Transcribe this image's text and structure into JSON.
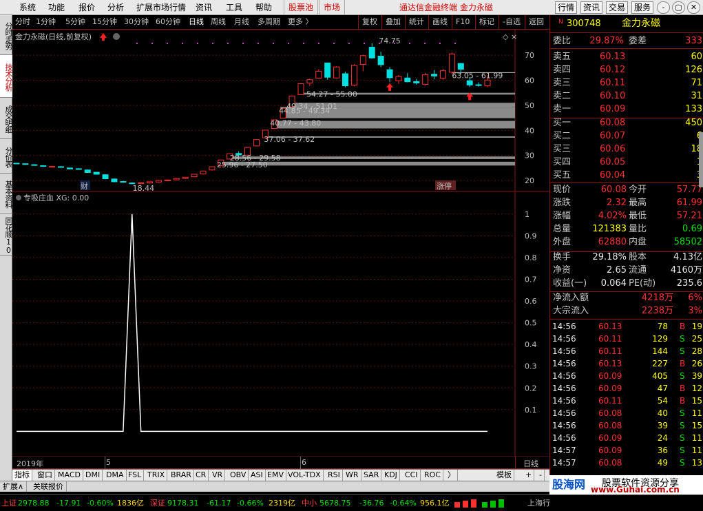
{
  "menubar": {
    "items": [
      "系统",
      "功能",
      "报价",
      "分析",
      "扩展市场行情",
      "资讯",
      "工具",
      "帮助",
      "股票池",
      "市场",
      "通达信金融终端  金力永磁"
    ],
    "right_buttons": [
      "行情",
      "资讯",
      "交易",
      "服务"
    ],
    "win_buttons": [
      "-",
      "▢",
      "✕"
    ]
  },
  "left_tabs": [
    "分时走势",
    "技术分析",
    "成交明细",
    "分价表",
    "基本资料",
    "同花顺10"
  ],
  "period_tabs": [
    "分时",
    "1分钟",
    "5分钟",
    "15分钟",
    "30分钟",
    "60分钟",
    "日线",
    "周线",
    "月线",
    "多周期",
    "更多 〉"
  ],
  "toolbar_buttons": [
    "复权",
    "叠加",
    "统计",
    "画线",
    "F10",
    "标记",
    "-自选",
    "返回"
  ],
  "chart_header": "金力永磁(日线,前复权)",
  "indicator_header": "专吸庄血  XG: 0.00",
  "date_labels": [
    "2019年",
    "5",
    "6"
  ],
  "period_label": "日线",
  "indicators": [
    "指标",
    "窗口",
    "MACD",
    "DMI",
    "DMA",
    "FSL",
    "TRIX",
    "BRAR",
    "CR",
    "VR",
    "OBV",
    "ASI",
    "EMV",
    "VOL-TDX",
    "RSI",
    "WR",
    "SAR",
    "KDJ",
    "CCI",
    "ROC",
    "〉",
    "模板",
    "+",
    "-"
  ],
  "ext_tabs": [
    "扩展∧",
    "关联报价"
  ],
  "status": {
    "sh_label": "上证",
    "sh_val": "2978.88",
    "sh_chg": "-17.91",
    "sh_pct": "-0.60%",
    "sh_amt": "1836亿",
    "sz_label": "深证",
    "sz_val": "9178.31",
    "sz_chg": "-61.17",
    "sz_pct": "-0.66%",
    "sz_amt": "2319亿",
    "zx_label": "中小",
    "zx_val": "5678.75",
    "zx_chg": "-36.76",
    "zx_pct": "-0.64%",
    "zx_amt": "956.1亿",
    "right": "上海行"
  },
  "stock": {
    "flag": "N",
    "code": "300748",
    "name": "金力永磁"
  },
  "weibi": {
    "l1": "委比",
    "v1": "29.87%",
    "l2": "委差",
    "v2": "333"
  },
  "asks": [
    {
      "label": "卖五",
      "price": "60.13",
      "vol": "60"
    },
    {
      "label": "卖四",
      "price": "60.12",
      "vol": "126"
    },
    {
      "label": "卖三",
      "price": "60.11",
      "vol": "71"
    },
    {
      "label": "卖二",
      "price": "60.10",
      "vol": "31"
    },
    {
      "label": "卖一",
      "price": "60.09",
      "vol": "133"
    }
  ],
  "bids": [
    {
      "label": "买一",
      "price": "60.08",
      "vol": "450"
    },
    {
      "label": "买二",
      "price": "60.07",
      "vol": "6"
    },
    {
      "label": "买三",
      "price": "60.06",
      "vol": "18"
    },
    {
      "label": "买四",
      "price": "60.05",
      "vol": "1"
    },
    {
      "label": "买五",
      "price": "60.04",
      "vol": "3"
    }
  ],
  "quote": [
    {
      "l1": "现价",
      "v1": "60.08",
      "l2": "今开",
      "v2": "57.77"
    },
    {
      "l1": "涨跌",
      "v1": "2.32",
      "l2": "最高",
      "v2": "61.99"
    },
    {
      "l1": "涨幅",
      "v1": "4.02%",
      "l2": "最低",
      "v2": "57.21"
    },
    {
      "l1": "总量",
      "v1": "121383",
      "l2": "量比",
      "v2": "0.69"
    },
    {
      "l1": "外盘",
      "v1": "62880",
      "l2": "内盘",
      "v2": "58502"
    }
  ],
  "fund": [
    {
      "l1": "换手",
      "v1": "29.18%",
      "l2": "股本",
      "v2": "4.13亿"
    },
    {
      "l1": "净资",
      "v1": "2.65",
      "l2": "流通",
      "v2": "4160万"
    },
    {
      "l1": "收益(一)",
      "v1": "0.064",
      "l2": "PE(动)",
      "v2": "235.6"
    }
  ],
  "flow": [
    {
      "l": "净流入额",
      "v": "4218万",
      "p": "6%"
    },
    {
      "l": "大宗流入",
      "v": "2238万",
      "p": "3%"
    }
  ],
  "ticks": [
    {
      "t": "14:56",
      "p": "60.13",
      "v": "78",
      "d": "B",
      "n": "19"
    },
    {
      "t": "14:56",
      "p": "60.11",
      "v": "129",
      "d": "S",
      "n": "25"
    },
    {
      "t": "14:56",
      "p": "60.11",
      "v": "144",
      "d": "S",
      "n": "28"
    },
    {
      "t": "14:56",
      "p": "60.13",
      "v": "227",
      "d": "B",
      "n": "26"
    },
    {
      "t": "14:56",
      "p": "60.09",
      "v": "405",
      "d": "S",
      "n": "39"
    },
    {
      "t": "14:56",
      "p": "60.09",
      "v": "47",
      "d": "B",
      "n": "12"
    },
    {
      "t": "14:56",
      "p": "60.11",
      "v": "54",
      "d": "B",
      "n": "15"
    },
    {
      "t": "14:56",
      "p": "60.08",
      "v": "40",
      "d": "S",
      "n": "11"
    },
    {
      "t": "14:56",
      "p": "60.08",
      "v": "39",
      "d": "S",
      "n": "15"
    },
    {
      "t": "14:56",
      "p": "60.09",
      "v": "24",
      "d": "S",
      "n": "11"
    },
    {
      "t": "14:57",
      "p": "60.09",
      "v": "36",
      "d": "S",
      "n": "11"
    },
    {
      "t": "14:57",
      "p": "60.08",
      "v": "49",
      "d": "S",
      "n": "13"
    }
  ],
  "logo": {
    "a": "股海网",
    "b": "股票软件资源分享",
    "url": "www.Guhai.com.cn"
  },
  "chart_data": [
    {
      "type": "candlestick",
      "title": "金力永磁(日线,前复权)",
      "y_ticks": [
        20.0,
        30.0,
        40.0,
        50.0,
        60.0,
        70.0
      ],
      "ylim": [
        17,
        78
      ],
      "candles": [
        [
          26.9,
          27.0,
          26.6,
          26.8
        ],
        [
          26.7,
          26.8,
          26.3,
          26.4
        ],
        [
          26.3,
          26.5,
          26.0,
          26.1
        ],
        [
          25.9,
          26.1,
          25.5,
          25.7
        ],
        [
          25.6,
          25.8,
          25.3,
          25.6
        ],
        [
          25.5,
          25.8,
          25.2,
          25.4
        ],
        [
          25.0,
          25.1,
          24.4,
          24.6
        ],
        [
          24.7,
          24.9,
          24.3,
          24.5
        ],
        [
          24.2,
          24.4,
          23.0,
          23.2
        ],
        [
          23.3,
          23.4,
          22.3,
          22.5
        ],
        [
          22.3,
          22.4,
          20.5,
          20.7
        ],
        [
          20.6,
          20.8,
          19.3,
          19.5
        ],
        [
          19.6,
          19.8,
          19.1,
          19.3
        ],
        [
          19.0,
          19.2,
          18.6,
          18.8
        ],
        [
          18.9,
          19.3,
          18.44,
          19.1
        ],
        [
          19.0,
          19.6,
          18.8,
          19.5
        ],
        [
          19.4,
          20.2,
          19.2,
          20.0
        ],
        [
          20.0,
          20.4,
          19.7,
          20.2
        ],
        [
          20.3,
          20.9,
          20.1,
          20.8
        ],
        [
          20.8,
          21.4,
          20.6,
          21.3
        ],
        [
          21.5,
          22.6,
          21.3,
          22.5
        ],
        [
          22.6,
          23.9,
          22.4,
          23.8
        ],
        [
          24.2,
          25.6,
          24.0,
          25.5
        ],
        [
          25.96,
          28.3,
          25.9,
          28.2
        ],
        [
          28.56,
          30.8,
          28.5,
          30.7
        ],
        [
          30.8,
          31.6,
          29.8,
          30.2
        ],
        [
          30.1,
          33.4,
          29.9,
          33.2
        ],
        [
          33.8,
          36.4,
          33.6,
          36.3
        ],
        [
          37.06,
          40.2,
          37.0,
          40.1
        ],
        [
          40.77,
          44.3,
          40.7,
          44.2
        ],
        [
          44.85,
          48.9,
          44.8,
          48.8
        ],
        [
          49.34,
          53.9,
          49.3,
          53.7
        ],
        [
          54.27,
          58.7,
          54.2,
          58.6
        ],
        [
          58.9,
          60.6,
          57.7,
          60.2
        ],
        [
          60.8,
          64.3,
          60.6,
          63.6
        ],
        [
          66.9,
          67.0,
          60.2,
          61.2
        ],
        [
          60.9,
          65.6,
          60.7,
          65.3
        ],
        [
          62.6,
          63.4,
          57.2,
          57.8
        ],
        [
          58.0,
          66.4,
          57.6,
          65.9
        ],
        [
          66.3,
          70.2,
          63.6,
          69.8
        ],
        [
          73.2,
          74.75,
          68.6,
          68.9
        ],
        [
          69.6,
          71.4,
          65.3,
          66.2
        ],
        [
          64.2,
          65.3,
          59.2,
          61.0
        ],
        [
          59.8,
          62.1,
          58.6,
          61.5
        ],
        [
          60.9,
          62.9,
          59.2,
          59.4
        ],
        [
          59.5,
          60.5,
          58.3,
          58.9
        ],
        [
          58.4,
          62.9,
          57.9,
          62.2
        ],
        [
          62.4,
          64.1,
          60.4,
          61.7
        ],
        [
          60.8,
          64.5,
          60.3,
          63.8
        ],
        [
          63.2,
          71.0,
          62.6,
          70.5
        ],
        [
          66.7,
          66.9,
          62.6,
          64.4
        ],
        [
          59.8,
          61.2,
          57.3,
          58.1
        ],
        [
          58.2,
          59.2,
          57.4,
          57.9
        ],
        [
          57.77,
          61.99,
          57.21,
          60.08
        ]
      ],
      "range_labels": [
        "74.75",
        "63.05 - 61.99",
        "54.27 - 55.00",
        "49.34 - 51.01",
        "44.85 - 49.34",
        "40.77 - 43.80",
        "37.06 - 37.62",
        "28.56 - 29.58",
        "25.96 - 27.50",
        "18.44"
      ],
      "markers": [
        "财",
        "涨停"
      ]
    },
    {
      "type": "line",
      "title": "专吸庄血",
      "series": [
        {
          "name": "XG",
          "values": [
            0,
            0,
            0,
            0,
            0,
            0,
            0,
            0,
            0,
            0,
            0,
            0,
            0,
            1,
            0,
            0,
            0,
            0,
            0,
            0,
            0,
            0,
            0,
            0,
            0,
            0,
            0,
            0,
            0,
            0,
            0,
            0,
            0,
            0,
            0,
            0,
            0,
            0,
            0,
            0,
            0,
            0,
            0,
            0,
            0,
            0,
            0,
            0,
            0,
            0,
            0,
            0,
            0,
            0
          ]
        }
      ],
      "y_ticks": [
        0.1,
        0.2,
        0.3,
        0.4,
        0.5,
        0.6,
        0.7,
        0.8,
        0.9,
        1.0
      ],
      "ylim": [
        -0.1,
        1.05
      ]
    }
  ]
}
